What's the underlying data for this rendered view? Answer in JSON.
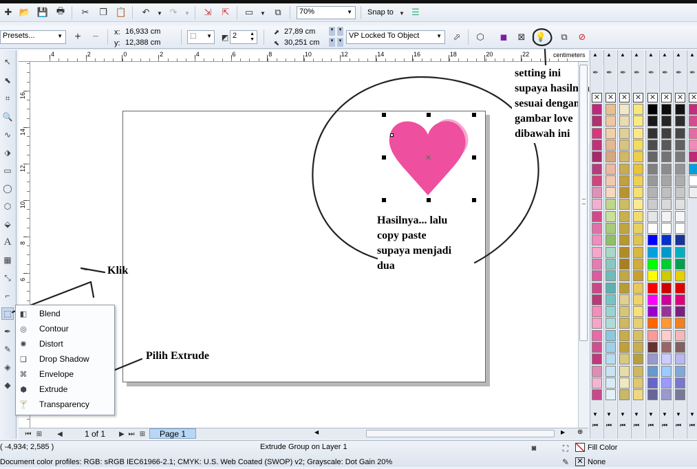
{
  "toolbar1": {
    "zoom_value": "70%",
    "snap_to_label": "Snap to"
  },
  "toolbar2": {
    "presets_value": "Presets...",
    "x_label": "x:",
    "x_value": "16,933 cm",
    "y_label": "y:",
    "y_value": "12,388 cm",
    "depth_value": "2",
    "vp_x_value": "27,89 cm",
    "vp_y_value": "30,251 cm",
    "vp_mode_value": "VP Locked To Object"
  },
  "ruler": {
    "unit": "centimeters",
    "h_ticks": [
      "4",
      "2",
      "0",
      "2",
      "4",
      "6",
      "8",
      "10",
      "12",
      "14",
      "16",
      "18",
      "20",
      "22"
    ],
    "v_ticks": [
      "16",
      "14",
      "12",
      "10",
      "8",
      "6"
    ]
  },
  "flyout": {
    "items": [
      "Blend",
      "Contour",
      "Distort",
      "Drop Shadow",
      "Envelope",
      "Extrude",
      "Transparency"
    ]
  },
  "annotations": {
    "klik": "Klik",
    "pilih": "Pilih Extrude",
    "setting_lines": [
      "setting ini",
      "supaya hasilnya",
      "sesuai dengan",
      "gambar love",
      "dibawah ini"
    ],
    "hasil_lines": [
      "Hasilnya... lalu",
      "copy paste",
      "supaya menjadi",
      "dua"
    ]
  },
  "pages": {
    "counter": "1 of 1",
    "tab_label": "Page 1"
  },
  "status": {
    "coords": "( -4,934; 2,585 )",
    "selection_info": "Extrude Group on Layer 1",
    "color_profiles": "Document color profiles: RGB: sRGB IEC61966-2.1; CMYK: U.S. Web Coated (SWOP) v2; Grayscale: Dot Gain 20%",
    "fill_label": "Fill Color",
    "outline_label": "None"
  },
  "colors": {
    "heart_front": "#ee4f9f",
    "heart_back": "#f7a8cf",
    "page_tab": "#b9d7f5"
  },
  "icons": [
    "new-icon",
    "open-icon",
    "save-icon",
    "print-icon",
    "cut-icon",
    "copy-icon",
    "paste-icon",
    "undo-icon",
    "redo-icon",
    "import-icon",
    "export-icon",
    "lightbulb-icon"
  ]
}
